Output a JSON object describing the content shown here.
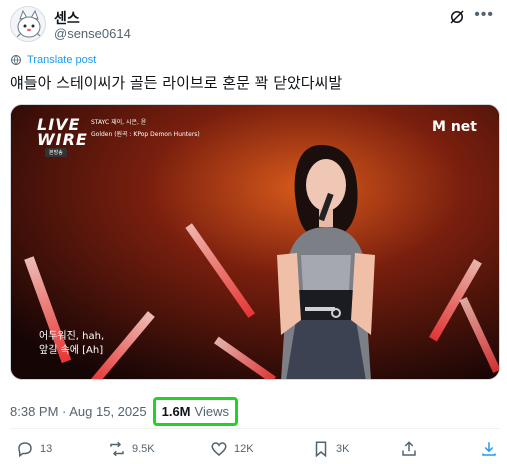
{
  "author": {
    "display_name": "센스",
    "handle": "@sense0614"
  },
  "tweet": {
    "translate_label": "Translate post",
    "text": "얘들아 스테이씨가 골든 라이브로 혼문 꽉 닫았다씨발"
  },
  "media": {
    "show_logo": "LIVE WIRE",
    "caption_line1": "STAYC 재이, 시은, 윤",
    "caption_line2": "Golden (원곡 : KPop Demon Hunters)",
    "badge": "본방송",
    "channel": "M net",
    "subtitle_line1": "어두워진, hah,",
    "subtitle_line2": "앞길 속에 [Ah]"
  },
  "meta": {
    "timestamp": "8:38 PM · Aug 15, 2025",
    "views_count": "1.6M",
    "views_label": "Views"
  },
  "actions": {
    "replies": "13",
    "reposts": "9.5K",
    "likes": "12K",
    "bookmarks": "3K"
  },
  "colors": {
    "accent": "#1d9bf0",
    "highlight": "#22d326"
  }
}
